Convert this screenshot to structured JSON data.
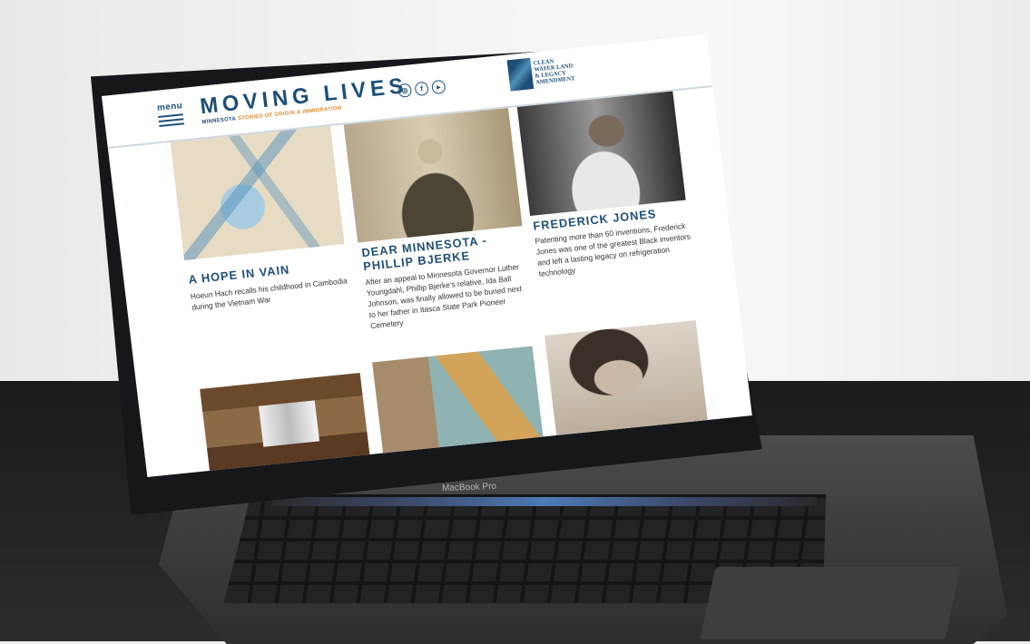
{
  "device": {
    "model_label": "MacBook Pro"
  },
  "header": {
    "menu_label": "menu",
    "brand_title": "MOVING LIVES",
    "brand_sub_state": "MINNESOTA",
    "brand_sub_rest": "STORIES OF ORIGIN & IMMIGRATION",
    "social": [
      {
        "icon": "instagram-icon",
        "glyph": "◎"
      },
      {
        "icon": "facebook-icon",
        "glyph": "f"
      },
      {
        "icon": "youtube-icon",
        "glyph": "▸"
      }
    ],
    "partner_logo_text": "CLEAN WATER LAND & LEGACY AMENDMENT"
  },
  "cards": [
    {
      "title": "A HOPE IN VAIN",
      "description": "Hoeun Hach recalls his childhood in Cambodia during the Vietnam War"
    },
    {
      "title": "DEAR MINNESOTA - PHILLIP BJERKE",
      "description": "After an appeal to Minnesota Governor Luther Youngdahl, Phillip Bjerke's relative, Ida Ball Johnson, was finally allowed to be buried next to her father in Itasca State Park Pioneer Cemetery"
    },
    {
      "title": "FREDERICK JONES",
      "description": "Patenting more than 60 inventions, Frederick Jones was one of the greatest Black inventors and left a lasting legacy on refrigeration technology"
    }
  ],
  "colors": {
    "brand_blue": "#1d4f76",
    "accent_orange": "#e38b2e"
  }
}
